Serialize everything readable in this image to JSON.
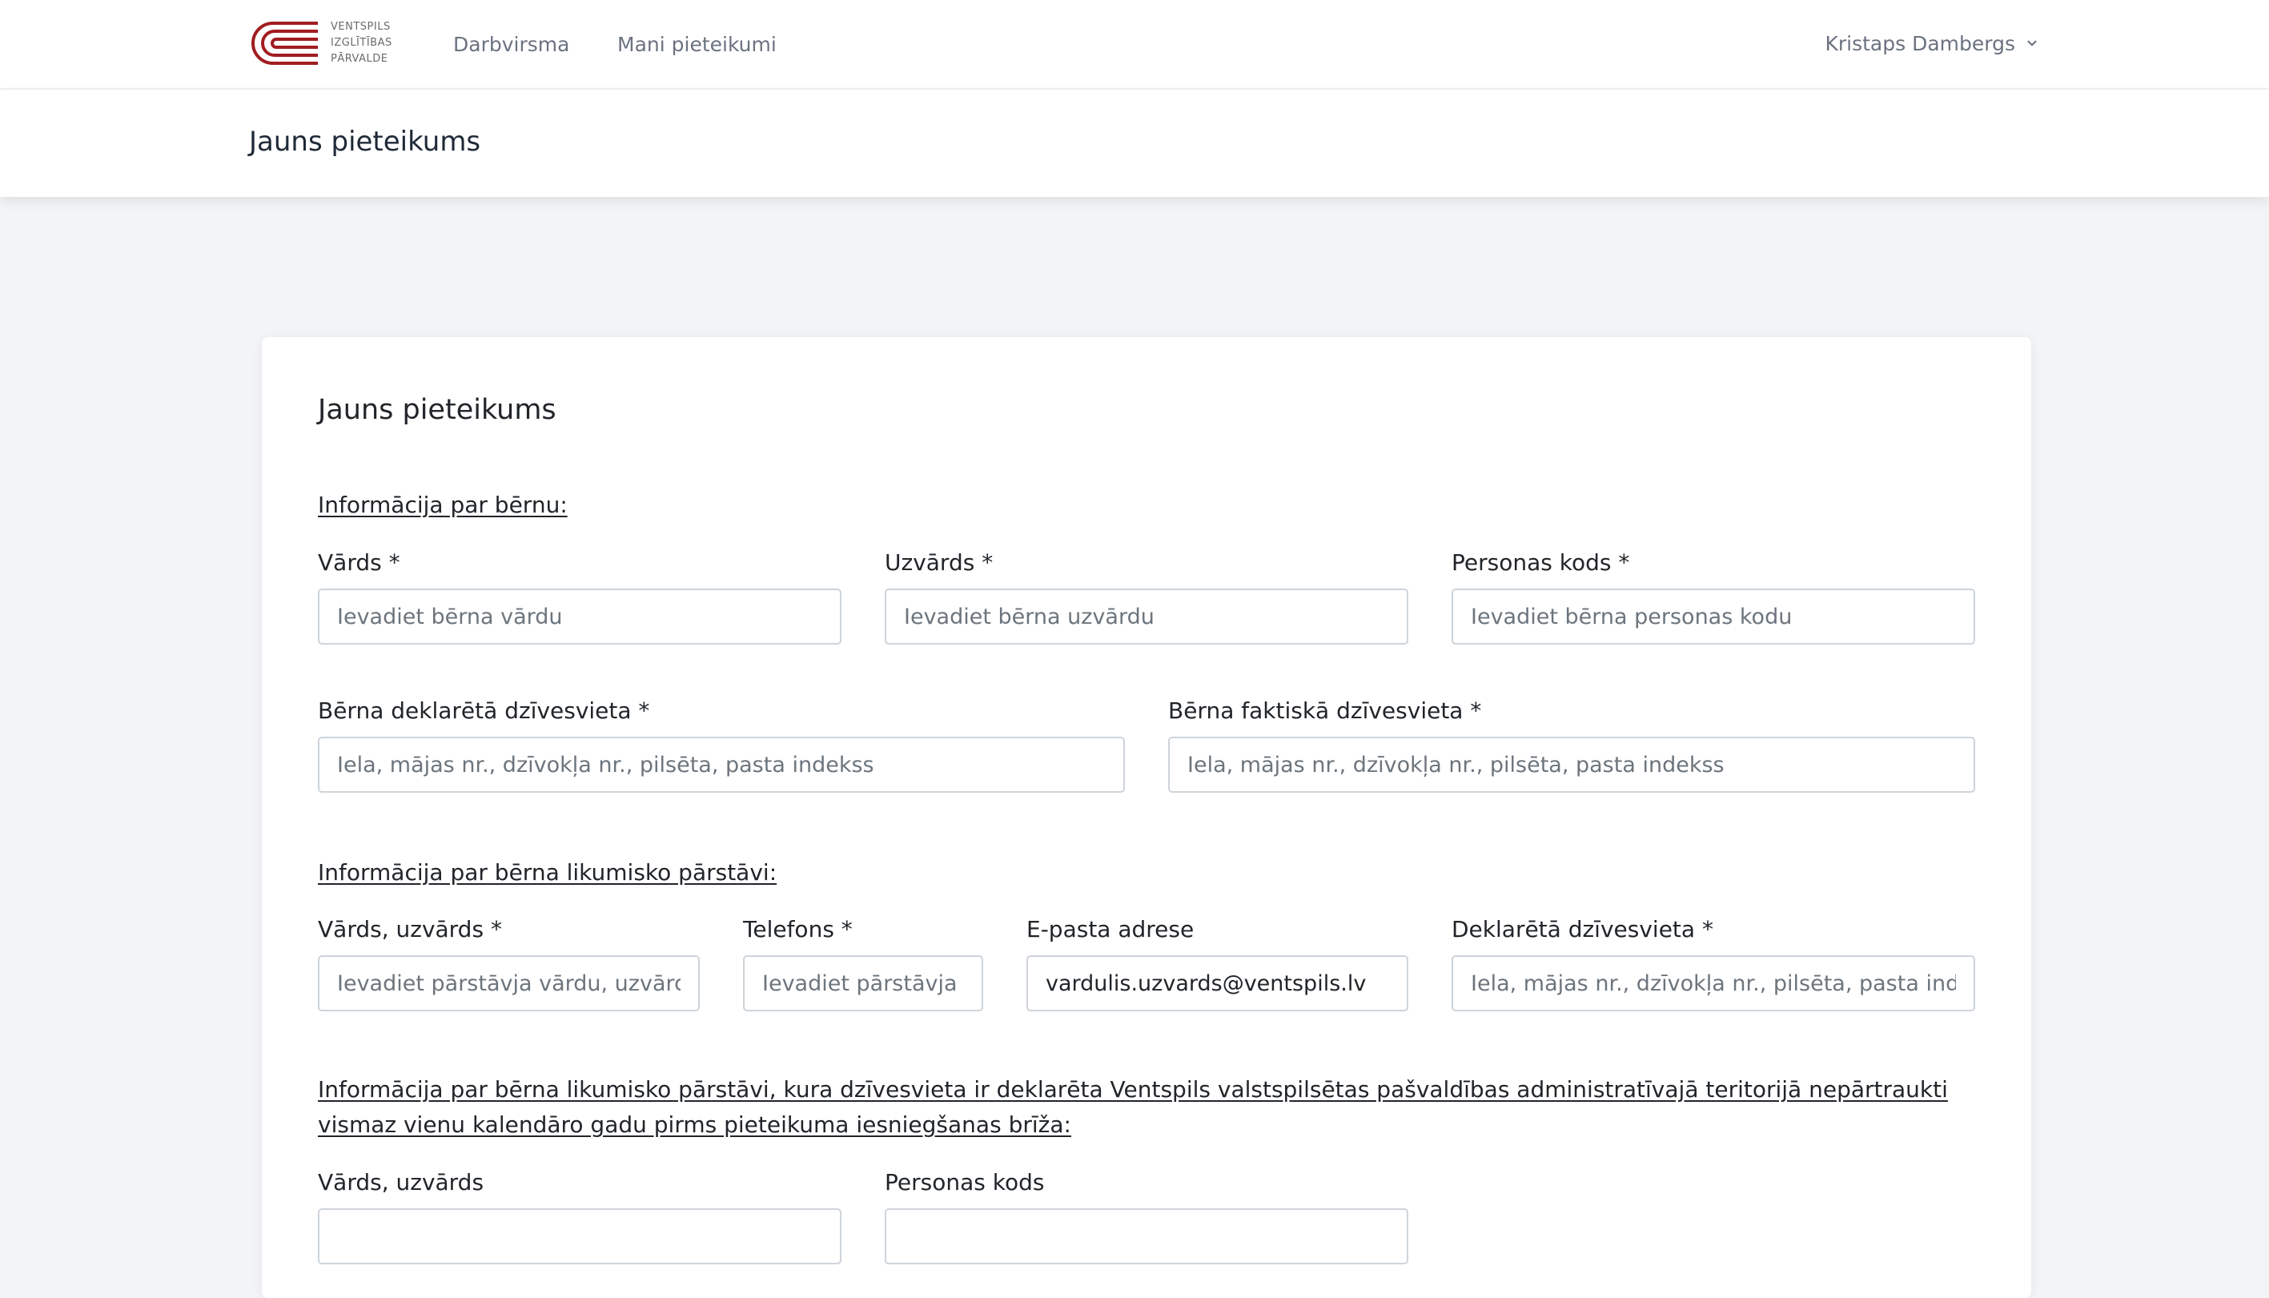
{
  "brand": {
    "logo_lines": [
      "VENTSPILS",
      "IZGLĪTĪBAS",
      "PĀRVALDE"
    ],
    "logo_color": "#a11d21"
  },
  "nav": {
    "dashboard": "Darbvirsma",
    "my_applications": "Mani pieteikumi",
    "user_name": "Kristaps Dambergs"
  },
  "header": {
    "title": "Jauns pieteikums"
  },
  "form": {
    "title": "Jauns pieteikums",
    "child_section": {
      "heading": "Informācija par bērnu:",
      "first_name": {
        "label": "Vārds *",
        "placeholder": "Ievadiet bērna vārdu",
        "value": ""
      },
      "last_name": {
        "label": "Uzvārds *",
        "placeholder": "Ievadiet bērna uzvārdu",
        "value": ""
      },
      "personal_code": {
        "label": "Personas kods *",
        "placeholder": "Ievadiet bērna personas kodu",
        "value": ""
      },
      "declared_address": {
        "label": "Bērna deklarētā dzīvesvieta *",
        "placeholder": "Iela, mājas nr., dzīvokļa nr., pilsēta, pasta indekss",
        "value": ""
      },
      "actual_address": {
        "label": "Bērna faktiskā dzīvesvieta *",
        "placeholder": "Iela, mājas nr., dzīvokļa nr., pilsēta, pasta indekss",
        "value": ""
      }
    },
    "guardian_section": {
      "heading": "Informācija par bērna likumisko pārstāvi:",
      "full_name": {
        "label": "Vārds, uzvārds *",
        "placeholder": "Ievadiet pārstāvja vārdu, uzvārdu",
        "value": ""
      },
      "phone": {
        "label": "Telefons *",
        "placeholder": "Ievadiet pārstāvja telefonu",
        "value": ""
      },
      "email": {
        "label": "E-pasta adrese",
        "placeholder": "",
        "value": "vardulis.uzvards@ventspils.lv"
      },
      "declared_address": {
        "label": "Deklarētā dzīvesvieta *",
        "placeholder": "Iela, mājas nr., dzīvokļa nr., pilsēta, pasta indekss",
        "value": ""
      }
    },
    "resident_guardian_section": {
      "heading": "Informācija par bērna likumisko pārstāvi, kura dzīvesvieta ir deklarēta Ventspils valstspilsētas pašvaldības administratīvajā teritorijā nepārtraukti vismaz vienu kalendāro gadu pirms pieteikuma iesniegšanas brīža:",
      "full_name": {
        "label": "Vārds, uzvārds",
        "placeholder": "",
        "value": ""
      },
      "personal_code": {
        "label": "Personas kods",
        "placeholder": "",
        "value": ""
      }
    }
  }
}
